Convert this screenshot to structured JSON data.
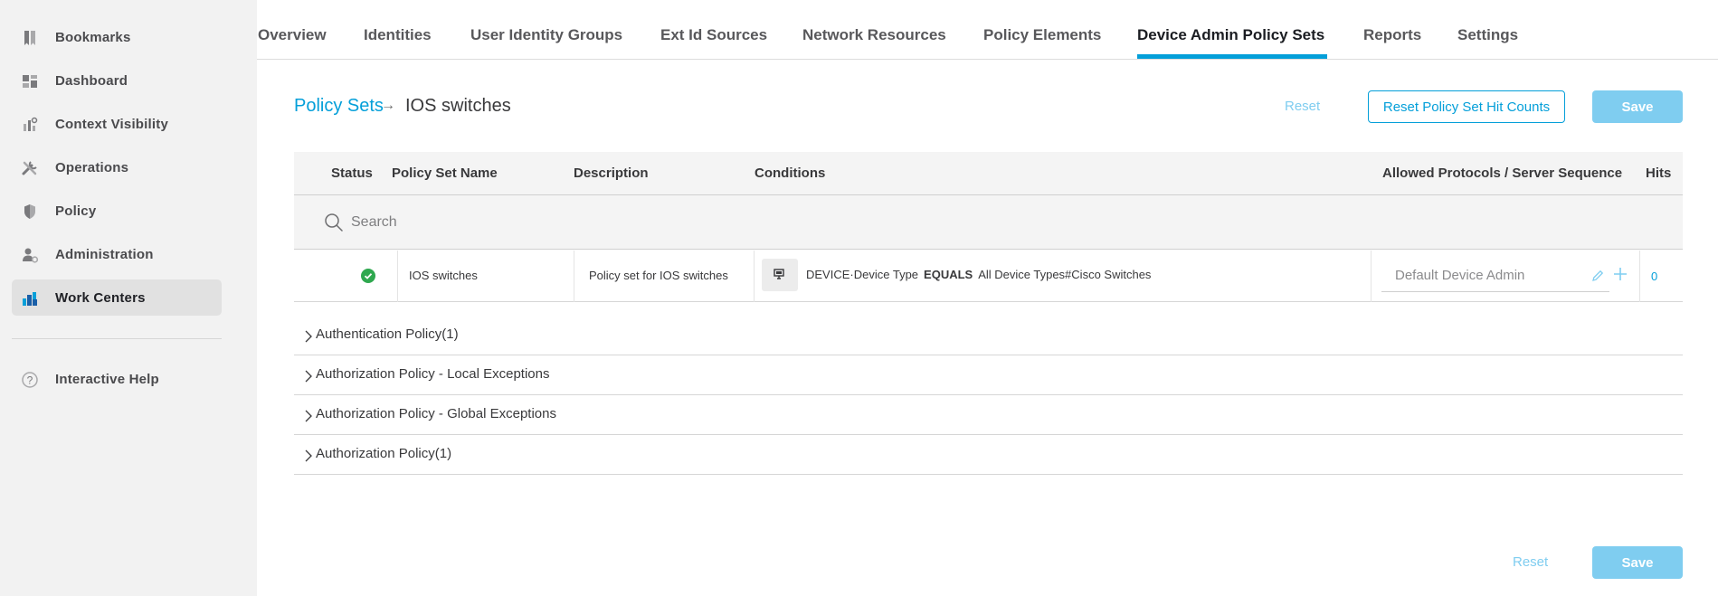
{
  "sidebar": {
    "items": [
      {
        "label": "Bookmarks",
        "icon": "bookmark-icon"
      },
      {
        "label": "Dashboard",
        "icon": "dashboard-icon"
      },
      {
        "label": "Context Visibility",
        "icon": "context-visibility-icon"
      },
      {
        "label": "Operations",
        "icon": "operations-icon"
      },
      {
        "label": "Policy",
        "icon": "policy-shield-icon"
      },
      {
        "label": "Administration",
        "icon": "administration-icon"
      },
      {
        "label": "Work Centers",
        "icon": "work-centers-icon",
        "active": true
      }
    ],
    "help": {
      "label": "Interactive Help",
      "icon": "help-icon"
    }
  },
  "nav": {
    "tabs": [
      {
        "label": "Overview"
      },
      {
        "label": "Identities"
      },
      {
        "label": "User Identity Groups"
      },
      {
        "label": "Ext Id Sources"
      },
      {
        "label": "Network Resources"
      },
      {
        "label": "Policy Elements"
      },
      {
        "label": "Device Admin Policy Sets",
        "active": true
      },
      {
        "label": "Reports"
      },
      {
        "label": "Settings"
      }
    ]
  },
  "header": {
    "breadcrumb_link": "Policy Sets",
    "breadcrumb_arrow": "→",
    "breadcrumb_current": "IOS switches",
    "reset_label": "Reset",
    "reset_hit_counts_label": "Reset Policy Set Hit Counts",
    "save_label": "Save"
  },
  "table": {
    "columns": {
      "status": "Status",
      "name": "Policy Set Name",
      "description": "Description",
      "conditions": "Conditions",
      "protocols": "Allowed Protocols / Server Sequence",
      "hits": "Hits"
    },
    "search_placeholder": "Search",
    "row": {
      "status": "enabled",
      "name": "IOS switches",
      "description": "Policy set for IOS switches",
      "condition_attribute": "DEVICE·Device Type",
      "condition_operator": "EQUALS",
      "condition_value": "All Device Types#Cisco Switches",
      "protocol": "Default Device Admin",
      "hits": "0"
    }
  },
  "sections": [
    {
      "label": "Authentication Policy(1)"
    },
    {
      "label": "Authorization Policy - Local Exceptions"
    },
    {
      "label": "Authorization Policy - Global Exceptions"
    },
    {
      "label": "Authorization Policy(1)"
    }
  ],
  "footer": {
    "reset_label": "Reset",
    "save_label": "Save"
  },
  "colors": {
    "accent": "#049fd9",
    "save_disabled": "#7fcdf0",
    "status_ok": "#2fa84f"
  }
}
